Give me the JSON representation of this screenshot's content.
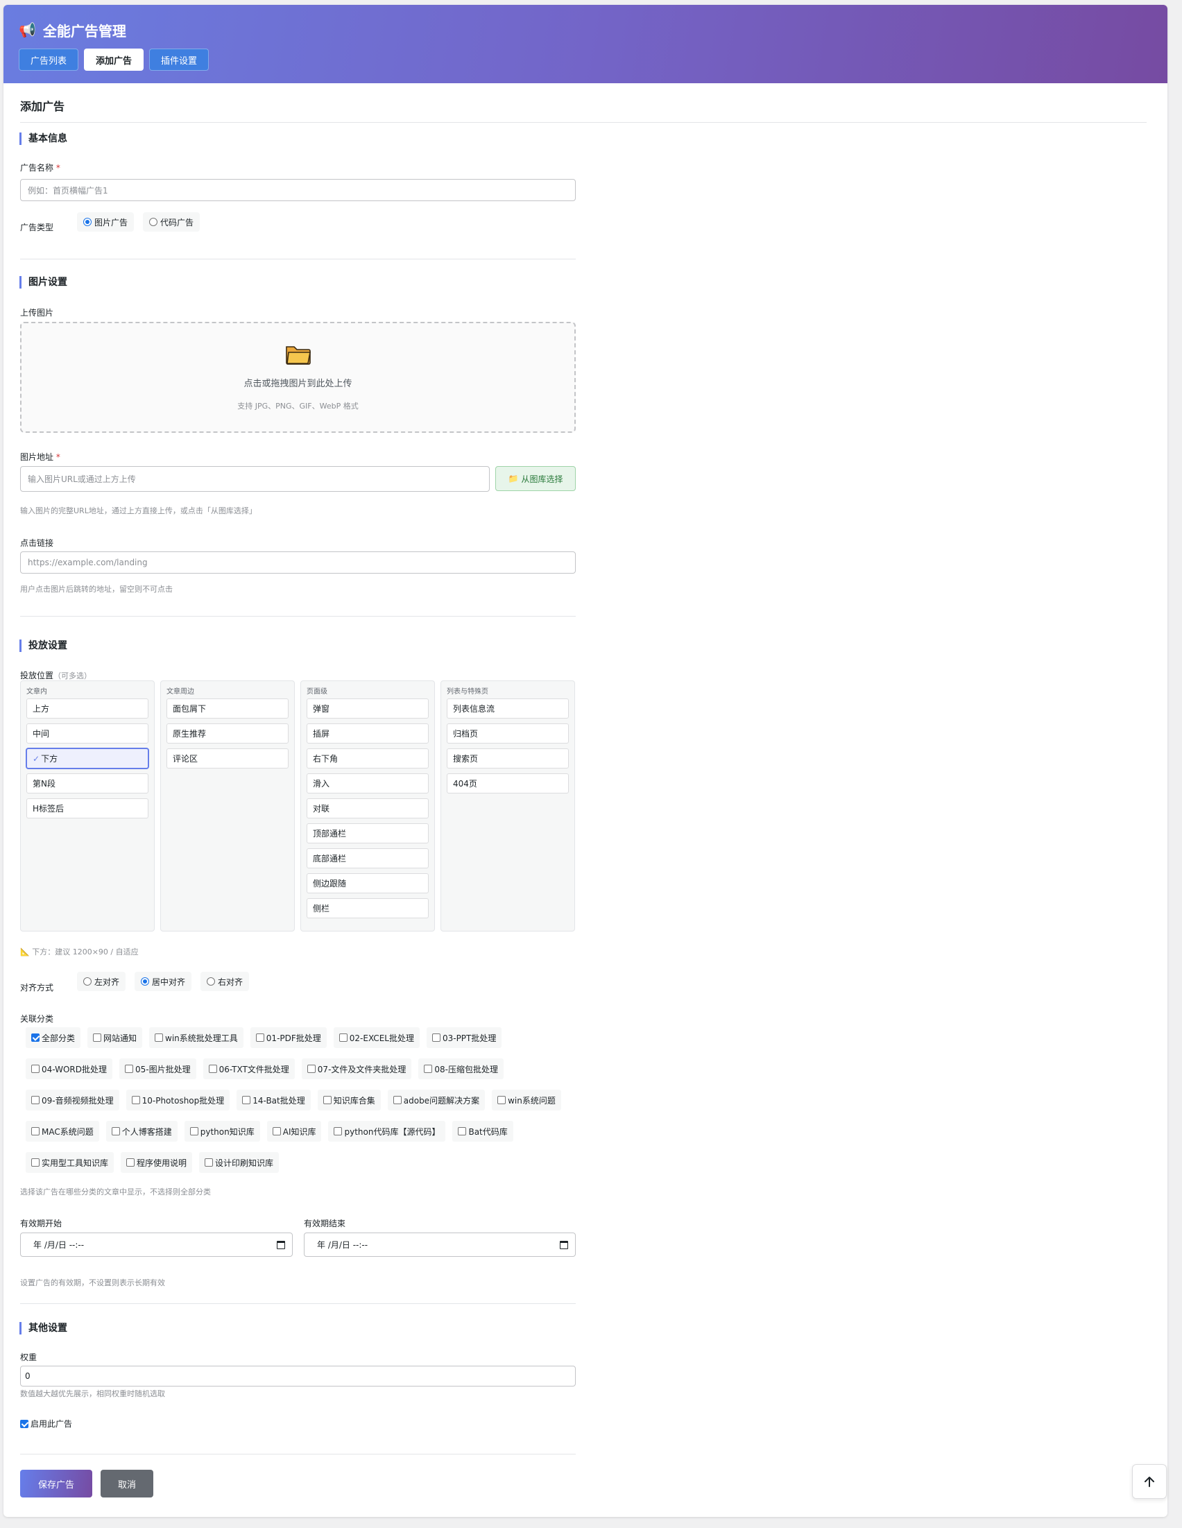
{
  "app": {
    "icon": "megaphone-icon",
    "title": "全能广告管理",
    "accent": "#667eea",
    "accent2": "#764ba2"
  },
  "tabs": [
    {
      "label": "广告列表",
      "active": false
    },
    {
      "label": "添加广告",
      "active": true
    },
    {
      "label": "插件设置",
      "active": false
    }
  ],
  "page_title": "添加广告",
  "basic": {
    "section": "基本信息",
    "name_label": "广告名称",
    "required_mark": "*",
    "name_placeholder": "例如：首页横幅广告1",
    "type_label": "广告类型",
    "type_options": [
      {
        "label": "图片广告",
        "checked": true
      },
      {
        "label": "代码广告",
        "checked": false
      }
    ]
  },
  "image": {
    "section": "图片设置",
    "upload_label": "上传图片",
    "upload_icon": "folder-icon",
    "upload_text": "点击或拖拽图片到此处上传",
    "upload_hint": "支持 JPG、PNG、GIF、WebP 格式",
    "url_label": "图片地址",
    "url_placeholder": "输入图片URL或通过上方上传",
    "library_button": "从图库选择",
    "url_hint": "输入图片的完整URL地址，通过上方直接上传，或点击「从图库选择」",
    "link_label": "点击链接",
    "link_placeholder": "https://example.com/landing",
    "link_hint": "用户点击图片后跳转的地址，留空则不可点击"
  },
  "placement": {
    "section": "投放设置",
    "position_label": "投放位置",
    "position_note": "（可多选）",
    "groups": [
      {
        "title": "文章内",
        "items": [
          {
            "label": "上方",
            "selected": false
          },
          {
            "label": "中间",
            "selected": false
          },
          {
            "label": "下方",
            "selected": true
          },
          {
            "label": "第N段",
            "selected": false
          },
          {
            "label": "H标签后",
            "selected": false
          }
        ]
      },
      {
        "title": "文章周边",
        "items": [
          {
            "label": "面包屑下",
            "selected": false
          },
          {
            "label": "原生推荐",
            "selected": false
          },
          {
            "label": "评论区",
            "selected": false
          }
        ]
      },
      {
        "title": "页面级",
        "items": [
          {
            "label": "弹窗",
            "selected": false
          },
          {
            "label": "插屏",
            "selected": false
          },
          {
            "label": "右下角",
            "selected": false
          },
          {
            "label": "滑入",
            "selected": false
          },
          {
            "label": "对联",
            "selected": false
          },
          {
            "label": "顶部通栏",
            "selected": false
          },
          {
            "label": "底部通栏",
            "selected": false
          },
          {
            "label": "侧边跟随",
            "selected": false
          },
          {
            "label": "侧栏",
            "selected": false
          }
        ]
      },
      {
        "title": "列表与特殊页",
        "items": [
          {
            "label": "列表信息流",
            "selected": false
          },
          {
            "label": "归档页",
            "selected": false
          },
          {
            "label": "搜索页",
            "selected": false
          },
          {
            "label": "404页",
            "selected": false
          }
        ]
      }
    ],
    "size_hint": "下方：建议 1200×90 / 自适应",
    "align_label": "对齐方式",
    "align_options": [
      {
        "label": "左对齐",
        "checked": false
      },
      {
        "label": "居中对齐",
        "checked": true
      },
      {
        "label": "右对齐",
        "checked": false
      }
    ],
    "category_label": "关联分类",
    "categories": [
      {
        "label": "全部分类",
        "checked": true
      },
      {
        "label": "网站通知",
        "checked": false
      },
      {
        "label": "win系统批处理工具",
        "checked": false
      },
      {
        "label": "01-PDF批处理",
        "checked": false
      },
      {
        "label": "02-EXCEL批处理",
        "checked": false
      },
      {
        "label": "03-PPT批处理",
        "checked": false
      },
      {
        "label": "04-WORD批处理",
        "checked": false
      },
      {
        "label": "05-图片批处理",
        "checked": false
      },
      {
        "label": "06-TXT文件批处理",
        "checked": false
      },
      {
        "label": "07-文件及文件夹批处理",
        "checked": false
      },
      {
        "label": "08-压缩包批处理",
        "checked": false
      },
      {
        "label": "09-音频视频批处理",
        "checked": false
      },
      {
        "label": "10-Photoshop批处理",
        "checked": false
      },
      {
        "label": "14-Bat批处理",
        "checked": false
      },
      {
        "label": "知识库合集",
        "checked": false
      },
      {
        "label": "adobe问题解决方案",
        "checked": false
      },
      {
        "label": "win系统问题",
        "checked": false
      },
      {
        "label": "MAC系统问题",
        "checked": false
      },
      {
        "label": "个人博客搭建",
        "checked": false
      },
      {
        "label": "python知识库",
        "checked": false
      },
      {
        "label": "AI知识库",
        "checked": false
      },
      {
        "label": "python代码库【源代码】",
        "checked": false
      },
      {
        "label": "Bat代码库",
        "checked": false
      },
      {
        "label": "实用型工具知识库",
        "checked": false
      },
      {
        "label": "程序使用说明",
        "checked": false
      },
      {
        "label": "设计印刷知识库",
        "checked": false
      }
    ],
    "category_hint": "选择该广告在哪些分类的文章中显示，不选择则全部分类",
    "start_label": "有效期开始",
    "end_label": "有效期结束",
    "date_placeholder": "年 /月/日 --:--",
    "date_hint": "设置广告的有效期，不设置则表示长期有效"
  },
  "other": {
    "section": "其他设置",
    "weight_label": "权重",
    "weight_value": "0",
    "weight_hint": "数值越大越优先展示，相同权重时随机选取",
    "enable_label": "启用此广告",
    "enable_checked": true
  },
  "actions": {
    "save": "保存广告",
    "cancel": "取消"
  },
  "back_to_top_icon": "arrow-up-icon"
}
